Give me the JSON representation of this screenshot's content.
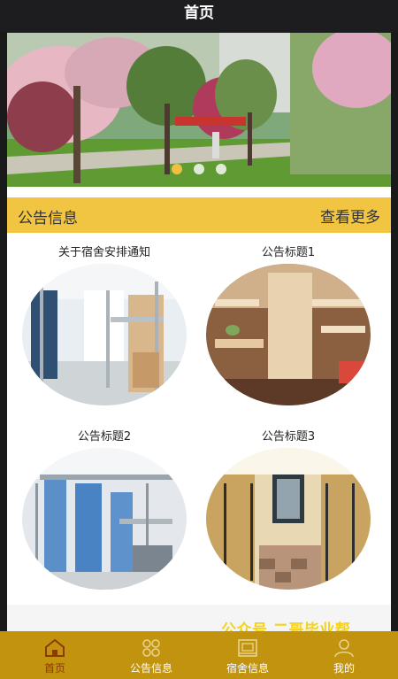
{
  "header": {
    "title": "首页"
  },
  "banner": {
    "dots": 3,
    "active_dot": 0
  },
  "notice": {
    "title": "公告信息",
    "more_label": "查看更多"
  },
  "cards": [
    {
      "title": "关于宿舍安排通知"
    },
    {
      "title": "公告标题1"
    },
    {
      "title": "公告标题2"
    },
    {
      "title": "公告标题3"
    }
  ],
  "watermark": "公众号 二哥毕业帮",
  "tabbar": {
    "items": [
      {
        "label": "首页",
        "icon": "home-icon",
        "active": true
      },
      {
        "label": "公告信息",
        "icon": "grid-icon",
        "active": false
      },
      {
        "label": "宿舍信息",
        "icon": "building-icon",
        "active": false
      },
      {
        "label": "我的",
        "icon": "user-icon",
        "active": false
      }
    ]
  },
  "colors": {
    "accent": "#f1c542",
    "tabbar": "#c2930e",
    "active_tab": "#8c3b00",
    "watermark": "#f5d21c"
  }
}
